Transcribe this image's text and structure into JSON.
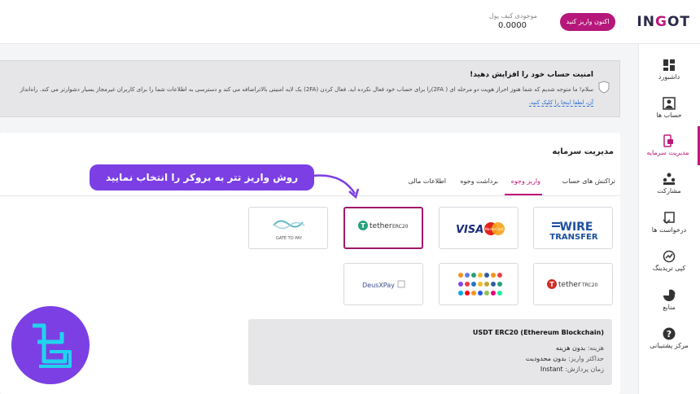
{
  "header": {
    "logo_prefix": "IN",
    "logo_o": "G",
    "logo_suffix": "OT",
    "deposit_button": "اکنون واریز کنید",
    "wallet_label": "موجودی کیف پول",
    "wallet_value": "0.0000"
  },
  "sidebar": {
    "items": [
      {
        "label": "داشبورد",
        "icon": "dashboard-icon"
      },
      {
        "label": "حساب ها",
        "icon": "accounts-icon"
      },
      {
        "label": "مدیریت سرمایه",
        "icon": "wallet-icon",
        "active": true
      },
      {
        "label": "مشارکت",
        "icon": "partnership-icon"
      },
      {
        "label": "درخواست ها",
        "icon": "requests-icon"
      },
      {
        "label": "کپی تریدینگ",
        "icon": "copy-trading-icon"
      },
      {
        "label": "منابع",
        "icon": "resources-icon"
      },
      {
        "label": "مرکز پشتیبانی",
        "icon": "help-icon"
      }
    ]
  },
  "security": {
    "title": "امنیت حساب خود را افزایش دهید!",
    "body": "سلام! ما متوجه شدیم که شما هنوز احراز هویت دو مرحله ای ( 2FA)را برای حساب خود فعال نکرده اید. فعال کردن (2FA) یک لایه امنیتی بالاتراضافه می کند و دسترسی به اطلاعات شما را برای کاربران غیرمجاز بسیار دشوارتر می کند. راه‌انداز",
    "link": "آن، لطفا اینجا را کلیک کنید."
  },
  "funds": {
    "title": "مدیریت سرمایه",
    "tabs": [
      "تراکنش های حساب",
      "واریز وجوه",
      "برداشت وجوه",
      "اطلاعات مالی"
    ],
    "active_tab": 1
  },
  "methods": [
    {
      "name": "wire-transfer",
      "line1": "WIRE",
      "line2": "TRANSFER"
    },
    {
      "name": "visa-mastercard",
      "line1": "VISA",
      "line2": "MasterCard"
    },
    {
      "name": "tether-erc20",
      "line1": "tether",
      "line2": "ERC20",
      "selected": true
    },
    {
      "name": "gate-to-pay",
      "line1": "GATE TO PAY"
    },
    {
      "name": "tether-trc20",
      "line1": "tether",
      "line2": "TRC20"
    },
    {
      "name": "crypto-coins"
    },
    {
      "name": "deusxpay",
      "line1": "DeusXPay"
    }
  ],
  "info": {
    "title": "USDT ERC20 (Ethereum Blockchain)",
    "fee_label": "هزینه:",
    "fee_value": "بدون هزینه",
    "max_label": "حداکثر واریز:",
    "max_value": "بدون محدودیت",
    "time_label": "زمان پردازش:",
    "time_value": "Instant"
  },
  "annotation": {
    "text": "روش واریز تتر به بروکر را انتخاب نمایید"
  },
  "colors": {
    "accent": "#c0187a",
    "annotation": "#7b3fe4",
    "selected_border": "#a0186a"
  }
}
